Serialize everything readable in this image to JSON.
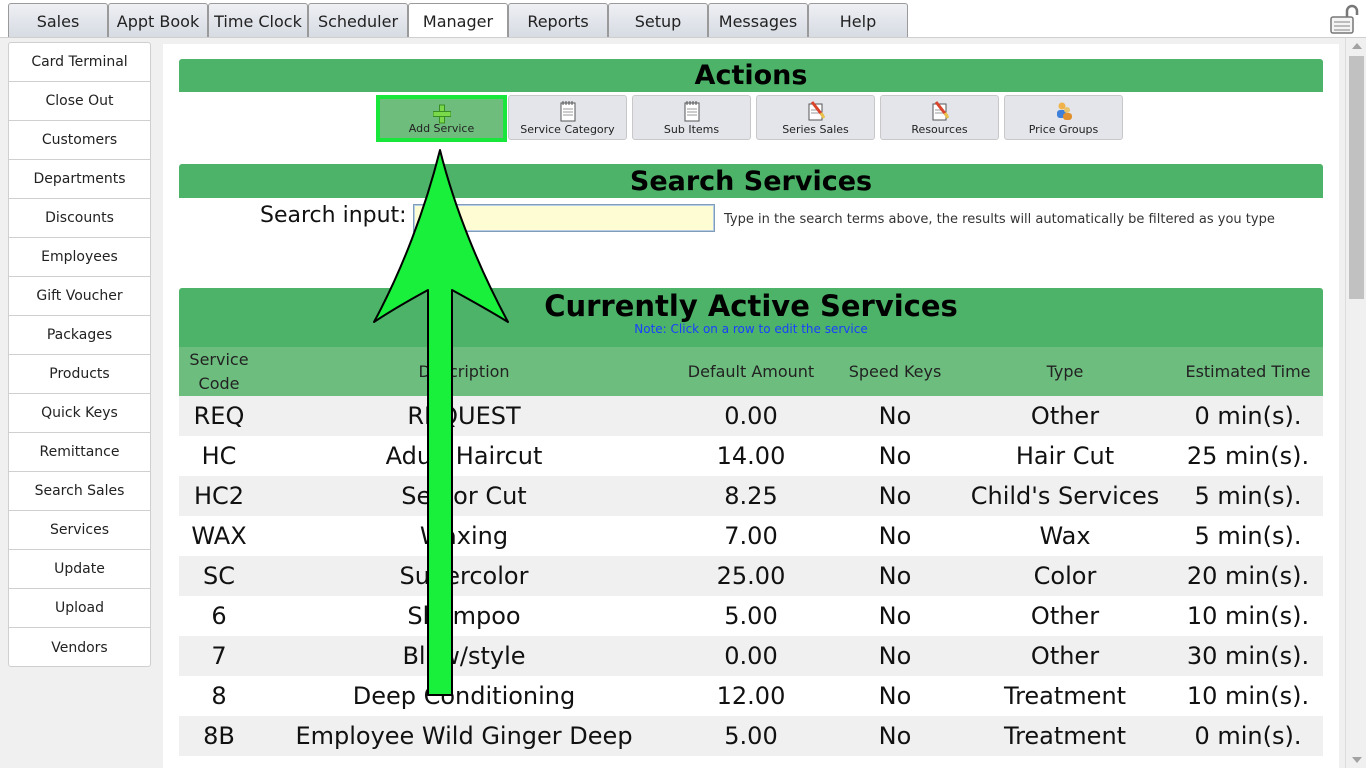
{
  "tabs": [
    {
      "label": "Sales"
    },
    {
      "label": "Appt Book"
    },
    {
      "label": "Time Clock"
    },
    {
      "label": "Scheduler"
    },
    {
      "label": "Manager"
    },
    {
      "label": "Reports"
    },
    {
      "label": "Setup"
    },
    {
      "label": "Messages"
    },
    {
      "label": "Help"
    }
  ],
  "active_tab": "Manager",
  "sidebar": {
    "items": [
      {
        "label": "Card Terminal"
      },
      {
        "label": "Close Out"
      },
      {
        "label": "Customers"
      },
      {
        "label": "Departments"
      },
      {
        "label": "Discounts"
      },
      {
        "label": "Employees"
      },
      {
        "label": "Gift Voucher"
      },
      {
        "label": "Packages"
      },
      {
        "label": "Products"
      },
      {
        "label": "Quick Keys"
      },
      {
        "label": "Remittance"
      },
      {
        "label": "Search Sales"
      },
      {
        "label": "Services"
      },
      {
        "label": "Update"
      },
      {
        "label": "Upload"
      },
      {
        "label": "Vendors"
      }
    ]
  },
  "actions": {
    "title": "Actions",
    "buttons": [
      {
        "label": "Add Service",
        "icon": "green-plus-icon"
      },
      {
        "label": "Service Category",
        "icon": "notepad-icon"
      },
      {
        "label": "Sub Items",
        "icon": "notepad-icon"
      },
      {
        "label": "Series Sales",
        "icon": "pencil-paper-icon"
      },
      {
        "label": "Resources",
        "icon": "pencil-paper-icon"
      },
      {
        "label": "Price Groups",
        "icon": "people-icon"
      }
    ]
  },
  "search": {
    "title": "Search Services",
    "label": "Search input:",
    "value": "",
    "hint": "Type in the search terms above, the results will automatically be filtered as you type"
  },
  "services": {
    "title": "Currently Active Services",
    "note": "Note: Click on a row to edit the service",
    "headers": {
      "code": "Service Code",
      "description": "Description",
      "amount": "Default Amount",
      "speed_keys": "Speed Keys",
      "type": "Type",
      "time": "Estimated Time"
    },
    "rows": [
      {
        "code": "REQ",
        "description": "REQUEST",
        "amount": "0.00",
        "speed_keys": "No",
        "type": "Other",
        "time": "0 min(s)."
      },
      {
        "code": "HC",
        "description": "Adult Haircut",
        "amount": "14.00",
        "speed_keys": "No",
        "type": "Hair Cut",
        "time": "25 min(s)."
      },
      {
        "code": "HC2",
        "description": "Senior Cut",
        "amount": "8.25",
        "speed_keys": "No",
        "type": "Child's Services",
        "time": "5 min(s)."
      },
      {
        "code": "WAX",
        "description": "Waxing",
        "amount": "7.00",
        "speed_keys": "No",
        "type": "Wax",
        "time": "5 min(s)."
      },
      {
        "code": "SC",
        "description": "Supercolor",
        "amount": "25.00",
        "speed_keys": "No",
        "type": "Color",
        "time": "20 min(s)."
      },
      {
        "code": "6",
        "description": "Shampoo",
        "amount": "5.00",
        "speed_keys": "No",
        "type": "Other",
        "time": "10 min(s)."
      },
      {
        "code": "7",
        "description": "Blow/style",
        "amount": "0.00",
        "speed_keys": "No",
        "type": "Other",
        "time": "30 min(s)."
      },
      {
        "code": "8",
        "description": "Deep Conditioning",
        "amount": "12.00",
        "speed_keys": "No",
        "type": "Treatment",
        "time": "10 min(s)."
      },
      {
        "code": "8B",
        "description": "Employee Wild Ginger Deep",
        "amount": "5.00",
        "speed_keys": "No",
        "type": "Treatment",
        "time": "0 min(s)."
      }
    ]
  },
  "annotation": {
    "icon": "big-green-arrow-icon",
    "color": "#19f03c"
  }
}
